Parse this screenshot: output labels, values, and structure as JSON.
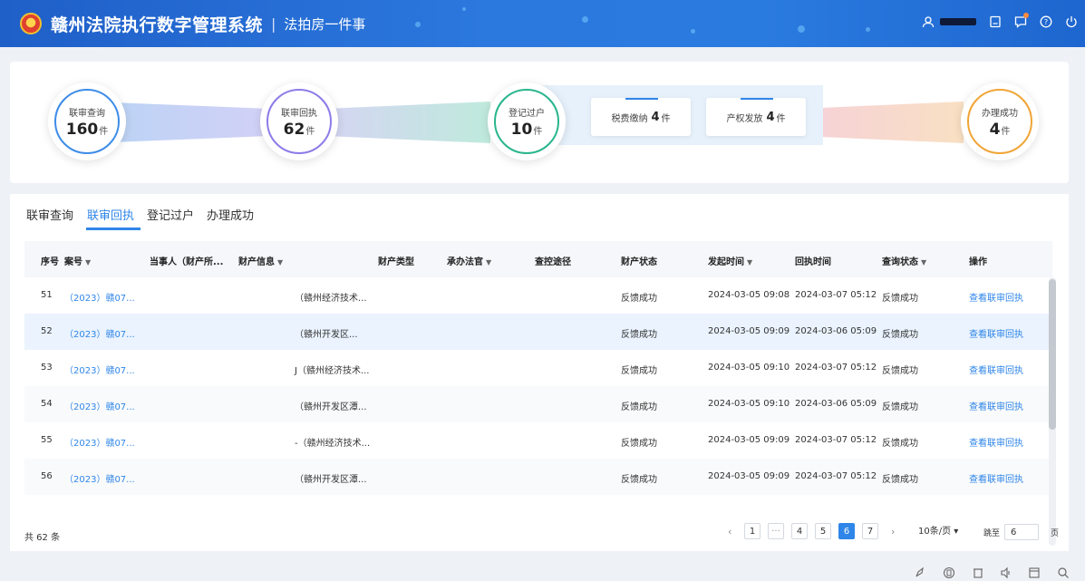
{
  "header": {
    "title": "赣州法院执行数字管理系统",
    "separator": "|",
    "subtitle": "法拍房一件事",
    "icons": [
      "user-icon",
      "document-icon",
      "message-icon",
      "help-icon",
      "power-icon"
    ]
  },
  "flow": {
    "steps": [
      {
        "label": "联审查询",
        "count": "160",
        "unit": "件",
        "color": "#3d8ce8"
      },
      {
        "label": "联审回执",
        "count": "62",
        "unit": "件",
        "color": "#8e7be8"
      },
      {
        "label": "登记过户",
        "count": "10",
        "unit": "件",
        "color": "#29b58d"
      },
      {
        "label": "办理成功",
        "count": "4",
        "unit": "件",
        "color": "#f0a537"
      }
    ],
    "sub_items": [
      {
        "label": "税费缴纳",
        "count": "4",
        "unit": "件"
      },
      {
        "label": "产权发放",
        "count": "4",
        "unit": "件"
      }
    ]
  },
  "tabs": [
    "联审查询",
    "联审回执",
    "登记过户",
    "办理成功"
  ],
  "active_tab": "联审回执",
  "table": {
    "columns": [
      "序号",
      "案号",
      "当事人（财产所...",
      "财产信息",
      "财产类型",
      "承办法官",
      "查控途径",
      "财产状态",
      "发起时间",
      "回执时间",
      "查询状态",
      "操作"
    ],
    "rows": [
      {
        "no": "51",
        "case": "（2023）赣07...",
        "asset": "（赣州经济技术...",
        "status": "反馈成功",
        "start": "2024-03-05 09:08",
        "receipt": "2024-03-07 05:12",
        "query": "反馈成功",
        "action": "查看联审回执"
      },
      {
        "no": "52",
        "case": "（2023）赣07...",
        "asset": "（赣州开发区...",
        "status": "反馈成功",
        "start": "2024-03-05 09:09",
        "receipt": "2024-03-06 05:09",
        "query": "反馈成功",
        "action": "查看联审回执"
      },
      {
        "no": "53",
        "case": "（2023）赣07...",
        "asset": "J（赣州经济技术...",
        "status": "反馈成功",
        "start": "2024-03-05 09:10",
        "receipt": "2024-03-07 05:12",
        "query": "反馈成功",
        "action": "查看联审回执"
      },
      {
        "no": "54",
        "case": "（2023）赣07...",
        "asset": "（赣州开发区潭...",
        "status": "反馈成功",
        "start": "2024-03-05 09:10",
        "receipt": "2024-03-06 05:09",
        "query": "反馈成功",
        "action": "查看联审回执"
      },
      {
        "no": "55",
        "case": "（2023）赣07...",
        "asset": "-（赣州经济技术...",
        "status": "反馈成功",
        "start": "2024-03-05 09:09",
        "receipt": "2024-03-07 05:12",
        "query": "反馈成功",
        "action": "查看联审回执"
      },
      {
        "no": "56",
        "case": "（2023）赣07...",
        "asset": "（赣州开发区潭...",
        "status": "反馈成功",
        "start": "2024-03-05 09:09",
        "receipt": "2024-03-07 05:12",
        "query": "反馈成功",
        "action": "查看联审回执"
      }
    ]
  },
  "pagination": {
    "total": "共 62 条",
    "pages": [
      "1",
      "···",
      "4",
      "5",
      "6",
      "7"
    ],
    "current": "6",
    "prev": "‹",
    "next": "›",
    "page_size": "10条/页 ▾",
    "jump_label": "跳至",
    "jump_value": "6",
    "page_suffix": "页"
  },
  "bottom_toolbar": [
    "rocket-icon",
    "copy-icon",
    "trash-icon",
    "volume-icon",
    "window-icon",
    "search-icon"
  ]
}
